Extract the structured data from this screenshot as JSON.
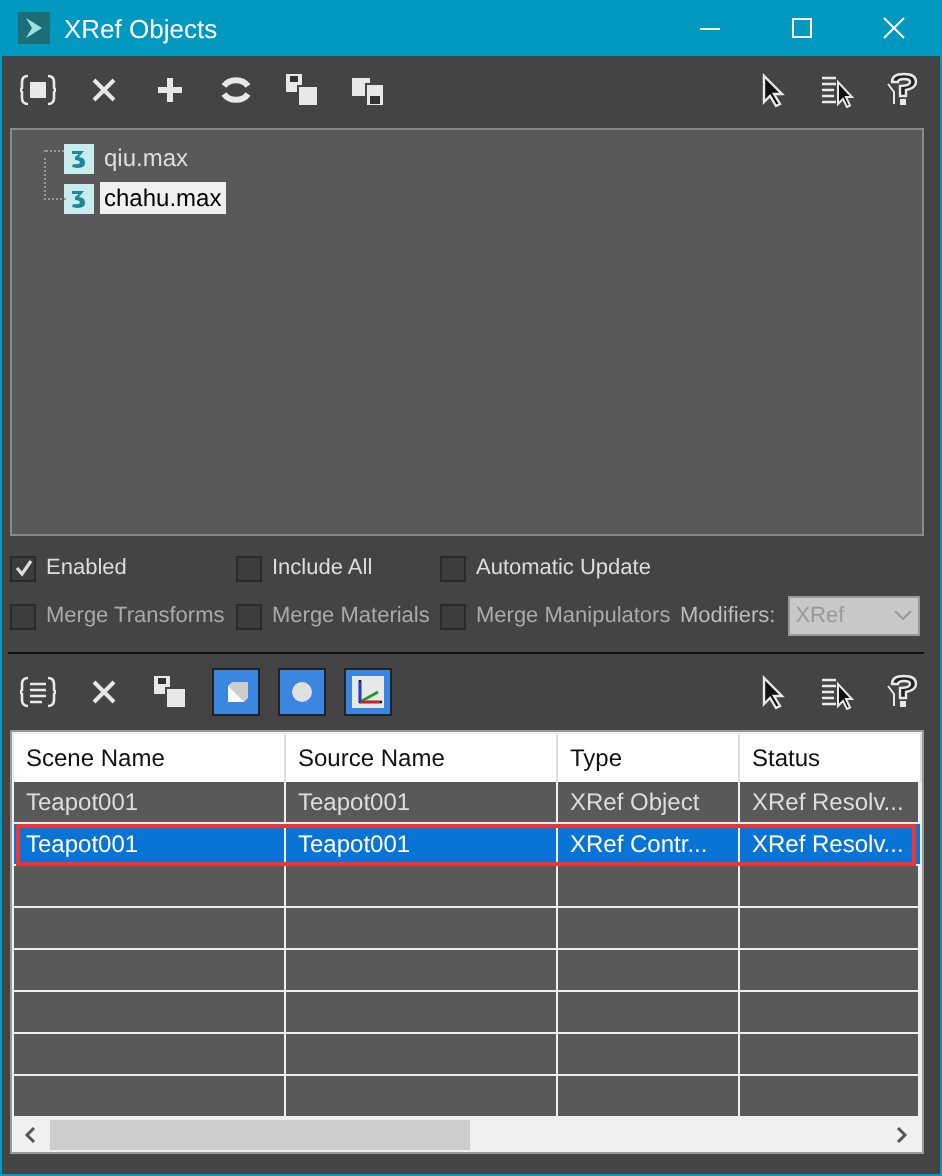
{
  "window": {
    "title": "XRef Objects"
  },
  "file_toolbar": {
    "left": [
      {
        "kind": "bracket"
      },
      {
        "kind": "close"
      },
      {
        "kind": "plus"
      },
      {
        "kind": "refresh"
      },
      {
        "kind": "merge"
      },
      {
        "kind": "merge2"
      }
    ],
    "right": [
      {
        "kind": "cursor"
      },
      {
        "kind": "list-cursor"
      },
      {
        "kind": "help"
      }
    ]
  },
  "files": [
    {
      "name": "qiu.max",
      "selected": false
    },
    {
      "name": "chahu.max",
      "selected": true
    }
  ],
  "options": {
    "row_1": [
      {
        "label": "Enabled",
        "checked": true
      },
      {
        "label": "Include All",
        "checked": false
      },
      {
        "label": "Automatic Update",
        "checked": false
      }
    ],
    "row_2": [
      {
        "label": "Merge Transforms",
        "checked": false,
        "disabled": true
      },
      {
        "label": "Merge Materials",
        "checked": false,
        "disabled": true
      },
      {
        "label": "Merge Manipulators",
        "checked": false,
        "disabled": true
      }
    ],
    "modifiers": {
      "label": "Modifiers:",
      "value": "XRef",
      "disabled": true
    }
  },
  "object_toolbar": {
    "left": [
      {
        "kind": "bracket-list"
      },
      {
        "kind": "close"
      },
      {
        "kind": "merge"
      },
      {
        "kind": "cube",
        "on": true
      },
      {
        "kind": "sphere",
        "on": true
      },
      {
        "kind": "axes",
        "on": true
      }
    ],
    "right": [
      {
        "kind": "cursor"
      },
      {
        "kind": "list-cursor"
      },
      {
        "kind": "help"
      }
    ]
  },
  "table": {
    "columns": [
      "Scene Name",
      "Source Name",
      "Type",
      "Status"
    ],
    "rows": [
      {
        "cells": [
          "Teapot001",
          "Teapot001",
          "XRef Object",
          "XRef Resolv..."
        ],
        "selected": false,
        "highlighted": false
      },
      {
        "cells": [
          "Teapot001",
          "Teapot001",
          "XRef Contr...",
          "XRef Resolv..."
        ],
        "selected": true,
        "highlighted": true
      }
    ]
  }
}
